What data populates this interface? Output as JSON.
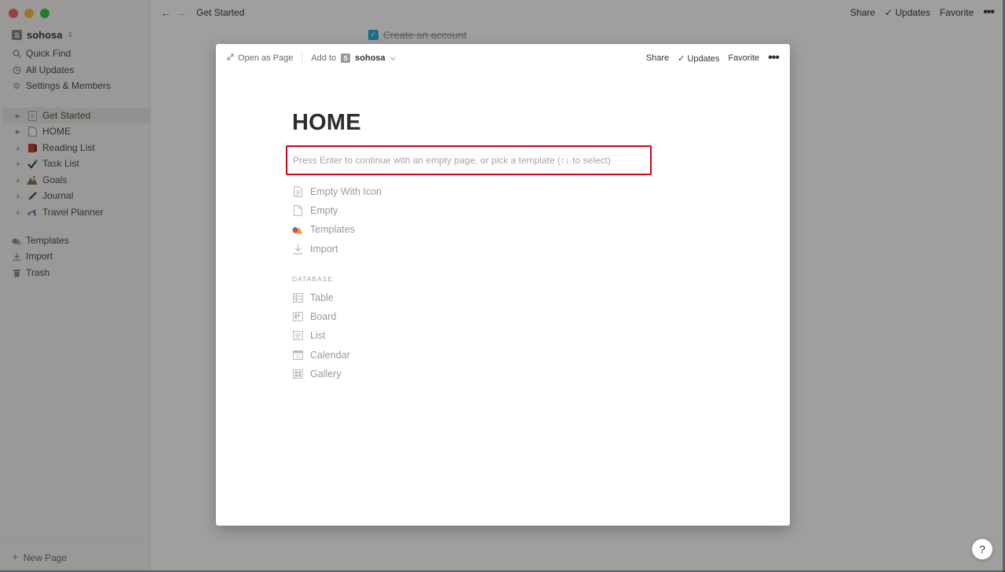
{
  "window": {
    "controls": [
      "close",
      "minimize",
      "zoom"
    ]
  },
  "sidebar": {
    "workspace": {
      "badge": "S",
      "name": "sohosa"
    },
    "nav": [
      {
        "label": "Quick Find",
        "icon": "search-icon"
      },
      {
        "label": "All Updates",
        "icon": "clock-icon"
      },
      {
        "label": "Settings & Members",
        "icon": "gear-icon"
      }
    ],
    "pages": [
      {
        "label": "Get Started",
        "icon": "document-icon",
        "active": true
      },
      {
        "label": "HOME",
        "icon": "blank-page-icon"
      },
      {
        "label": "Reading List",
        "icon": "book-emoji-icon"
      },
      {
        "label": "Task List",
        "icon": "check-emoji-icon"
      },
      {
        "label": "Goals",
        "icon": "mountain-emoji-icon"
      },
      {
        "label": "Journal",
        "icon": "pen-emoji-icon"
      },
      {
        "label": "Travel Planner",
        "icon": "airplane-emoji-icon"
      }
    ],
    "tools": [
      {
        "label": "Templates",
        "icon": "templates-icon"
      },
      {
        "label": "Import",
        "icon": "import-icon"
      },
      {
        "label": "Trash",
        "icon": "trash-icon"
      }
    ],
    "new_page": "New Page"
  },
  "topbar": {
    "breadcrumb": "Get Started",
    "share": "Share",
    "updates": "Updates",
    "favorite": "Favorite"
  },
  "background_page": {
    "todo_text": "Create an account",
    "checked": true
  },
  "modal": {
    "open_as_page": "Open as Page",
    "add_to": "Add to",
    "workspace_badge": "S",
    "workspace_name": "sohosa",
    "share": "Share",
    "updates": "Updates",
    "favorite": "Favorite",
    "title": "HOME",
    "placeholder": "Press Enter to continue with an empty page, or pick a template (↑↓ to select)",
    "options": [
      {
        "label": "Empty With Icon",
        "icon": "document-lines-icon"
      },
      {
        "label": "Empty",
        "icon": "blank-page-icon"
      },
      {
        "label": "Templates",
        "icon": "templates-icon"
      },
      {
        "label": "Import",
        "icon": "import-icon"
      }
    ],
    "database_heading": "DATABASE",
    "database_options": [
      {
        "label": "Table",
        "icon": "table-icon"
      },
      {
        "label": "Board",
        "icon": "board-icon"
      },
      {
        "label": "List",
        "icon": "list-icon"
      },
      {
        "label": "Calendar",
        "icon": "calendar-icon"
      },
      {
        "label": "Gallery",
        "icon": "gallery-icon"
      }
    ]
  },
  "help": "?",
  "colors": {
    "highlight_border": "#d0021b",
    "checkbox": "#2eaadc",
    "sidebar_bg": "#f7f6f3"
  }
}
